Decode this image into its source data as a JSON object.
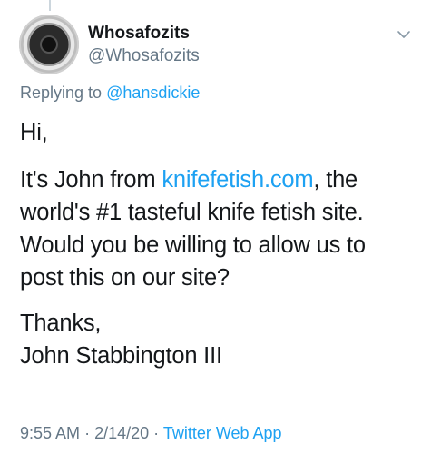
{
  "tweet": {
    "display_name": "Whosafozits",
    "handle": "@Whosafozits",
    "replying_prefix": "Replying to",
    "replying_to": "@hansdickie",
    "greeting": "Hi,",
    "para2_part1": "It's John from ",
    "para2_link": "knifefetish.com",
    "para2_line1_rest": ", the",
    "para2_line2": "world's #1 tasteful knife fetish site.",
    "para2_line3": "Would you be willing to allow us to",
    "para2_line4": "post this on our site?",
    "signoff": "Thanks,",
    "signature": "John Stabbington III",
    "time": "9:55 AM",
    "date": "2/14/20",
    "source": "Twitter Web App",
    "separator": "·"
  },
  "icons": {
    "avatar": "safe-dial-avatar",
    "menu": "chevron-down-icon"
  },
  "colors": {
    "link_blue": "#1da1f2",
    "secondary_gray": "#657786",
    "text_dark": "#14171a"
  }
}
